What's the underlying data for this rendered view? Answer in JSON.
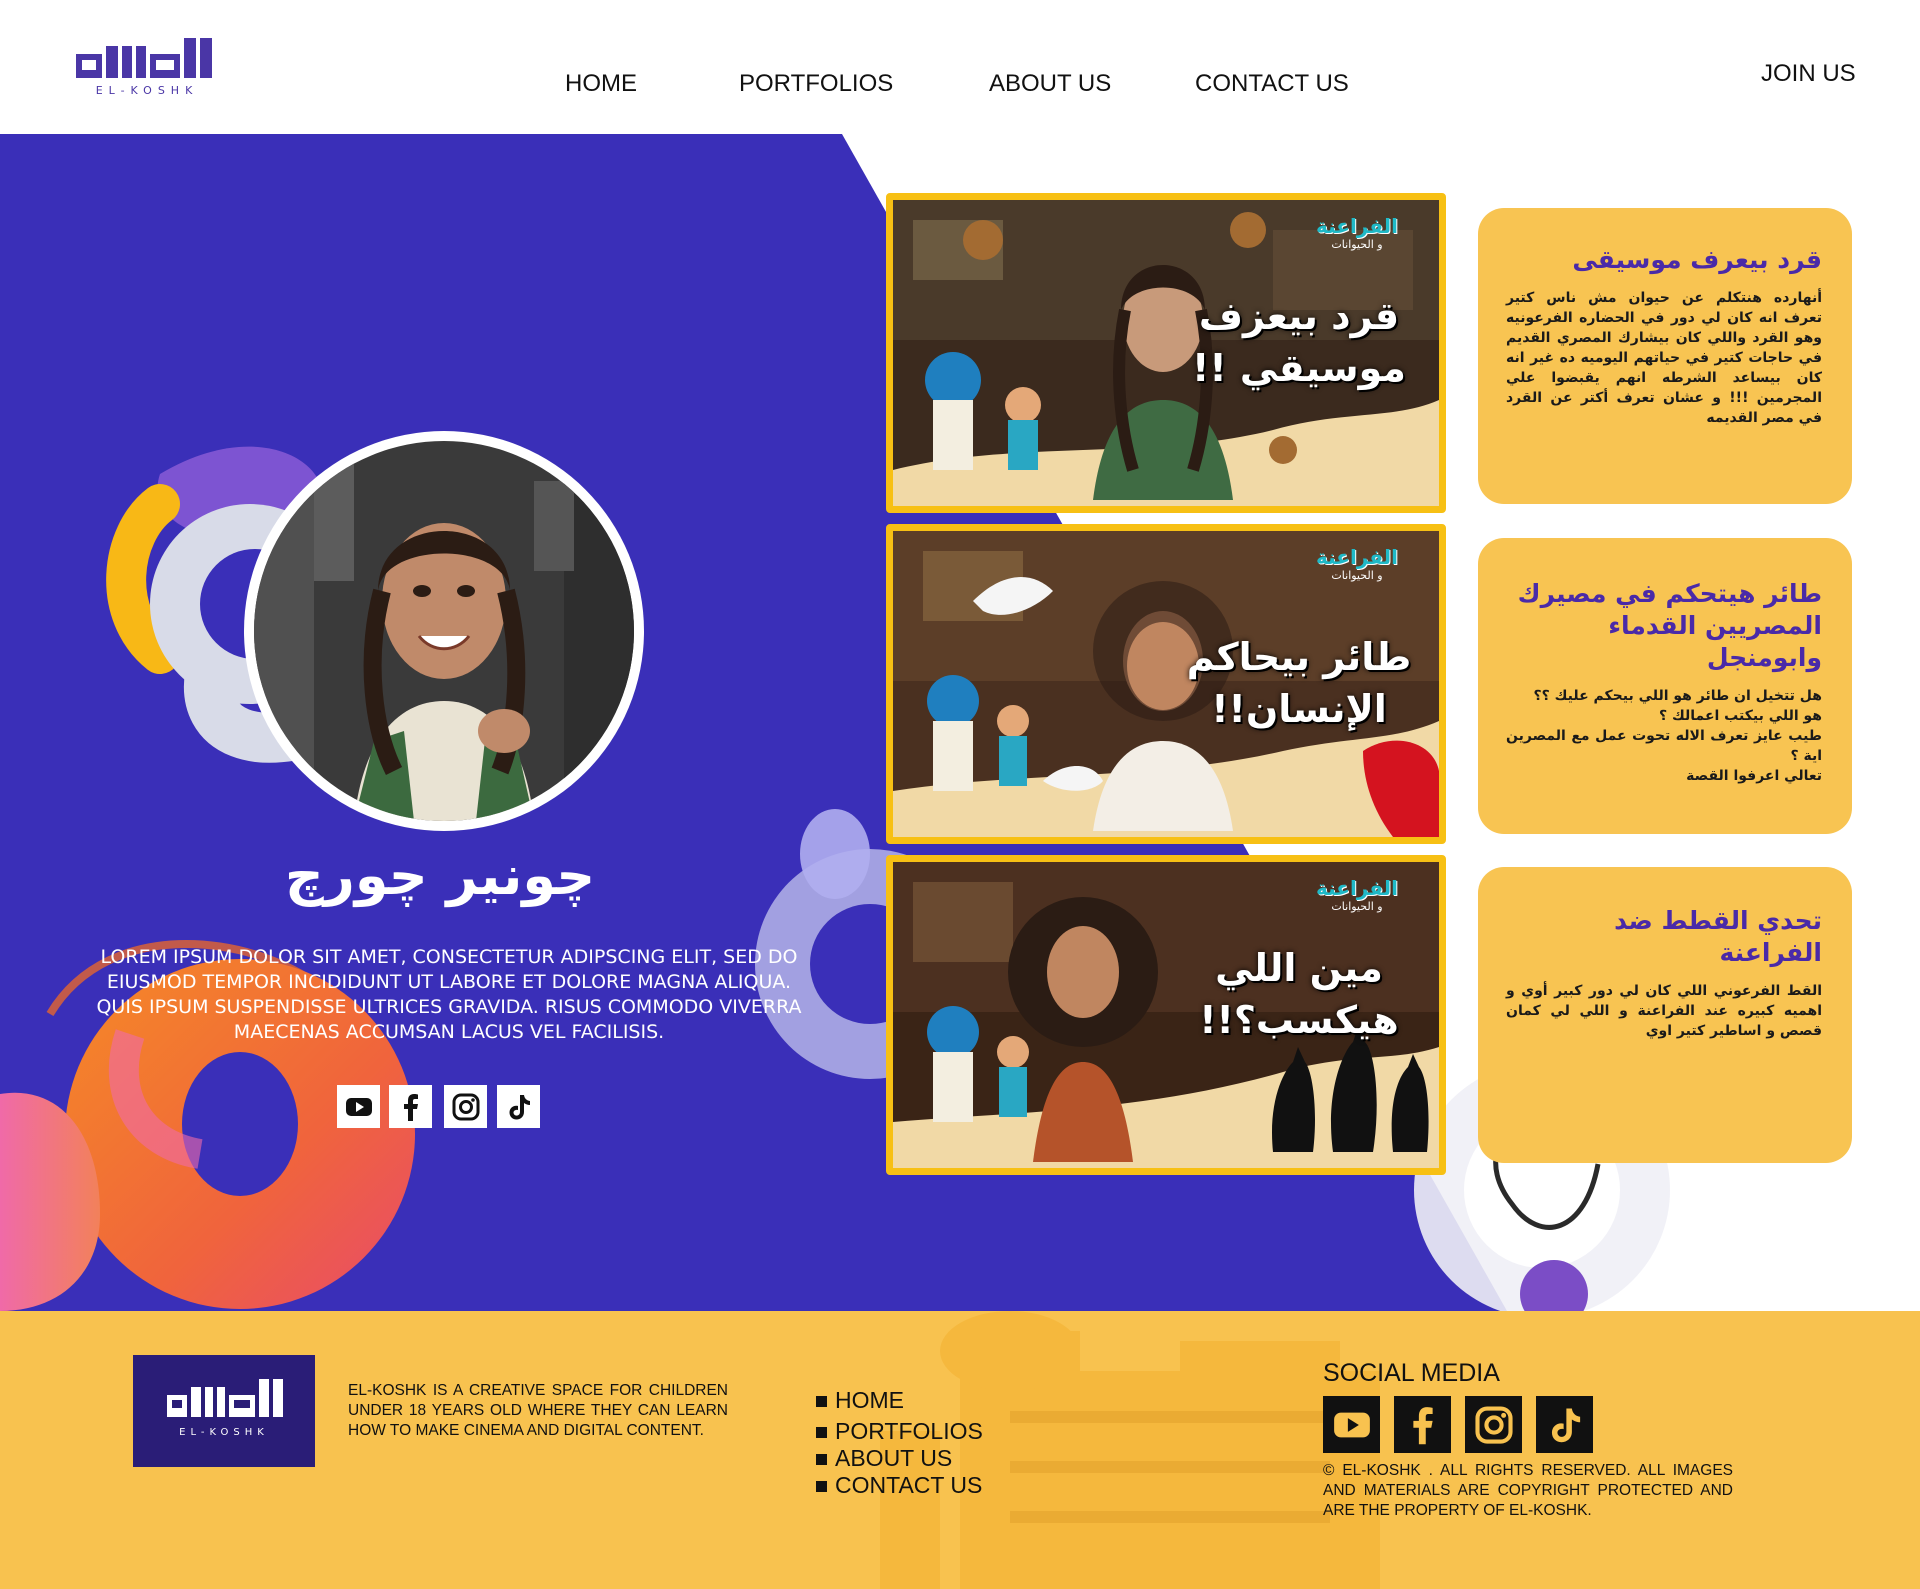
{
  "brand": {
    "logo_text": "EL-KOSHK"
  },
  "nav": {
    "items": [
      {
        "label": "HOME"
      },
      {
        "label": "PORTFOLIOS"
      },
      {
        "label": "ABOUT US"
      },
      {
        "label": "CONTACT US"
      }
    ],
    "join_label": "JOIN US"
  },
  "profile": {
    "name": "چونير چورچ",
    "bio": "LOREM IPSUM DOLOR SIT AMET, CONSECTETUR ADIPSCING ELIT, SED DO EIUSMOD TEMPOR INCIDIDUNT UT LABORE ET DOLORE MAGNA ALIQUA. QUIS IPSUM SUSPENDISSE ULTRICES GRAVIDA. RISUS COMMODO VIVERRA MAECENAS ACCUMSAN LACUS VEL FACILISIS.",
    "social": [
      {
        "icon": "youtube-icon"
      },
      {
        "icon": "facebook-icon"
      },
      {
        "icon": "instagram-icon"
      },
      {
        "icon": "tiktok-icon"
      }
    ]
  },
  "videos": [
    {
      "thumb_logo": "الفراعنة",
      "thumb_sub": "و الحيوانات",
      "thumb_title": "قرد بيعزف موسيقي !!",
      "title": "قرد بيعرف موسيقى",
      "description": "أنهارده هنتكلم عن حيوان مش ناس كتير تعرف انه كان لي دور في الحضاره الفرعونيه وهو القرد واللي كان بيشارك المصري القديم في حاجات كتير في حياتهم اليوميه ده غير انه كان بيساعد الشرطه انهم يقبضوا علي المجرمين !!! و عشان تعرف أكتر عن القرد في مصر القديمه"
    },
    {
      "thumb_logo": "الفراعنة",
      "thumb_sub": "و الحيوانات",
      "thumb_title": "طائر بيحاكم الإنسان!!",
      "title": "طائر هيتحكم في مصيرك المصريين القدماء وابومنجل",
      "description": "هل تتخيل ان طائر هو اللي بيحكم عليك ؟؟\nهو اللي بيكتب اعمالك ؟\nطيب عايز تعرف الاله تحوت عمل مع المصرين اية ؟\nتعالي اعرفوا القصة"
    },
    {
      "thumb_logo": "الفراعنة",
      "thumb_sub": "و الحيوانات",
      "thumb_title": "مين اللي هيكسب؟!!",
      "title": "تحدي القطط ضد الفراعنة",
      "description": "القط الفرعوني اللي كان لي دور كبير أوي و اهميه كبيره عند الفراعنة و اللي لي كمان قصص و اساطير كتير اوي"
    }
  ],
  "footer": {
    "logo_text": "EL-KOSHK",
    "about": "EL-KOSHK IS A CREATIVE SPACE FOR CHILDREN UNDER 18 YEARS OLD WHERE THEY CAN LEARN HOW TO MAKE CINEMA AND DIGITAL CONTENT.",
    "links": [
      {
        "label": "HOME"
      },
      {
        "label": "PORTFOLIOS"
      },
      {
        "label": "ABOUT US"
      },
      {
        "label": "CONTACT US"
      }
    ],
    "social_title": "SOCIAL MEDIA",
    "social": [
      {
        "icon": "youtube-icon"
      },
      {
        "icon": "facebook-icon"
      },
      {
        "icon": "instagram-icon"
      },
      {
        "icon": "tiktok-icon"
      }
    ],
    "copyright": "© EL-KOSHK . ALL RIGHTS RESERVED. ALL IMAGES AND MATERIALS ARE COPYRIGHT PROTECTED AND ARE THE PROPERTY OF EL-KOSHK."
  },
  "colors": {
    "hero_blue": "#3a2fb8",
    "card_yellow": "#f8c452",
    "accent_purple": "#4a2aa8",
    "footer_yellow": "#f8c24f"
  }
}
